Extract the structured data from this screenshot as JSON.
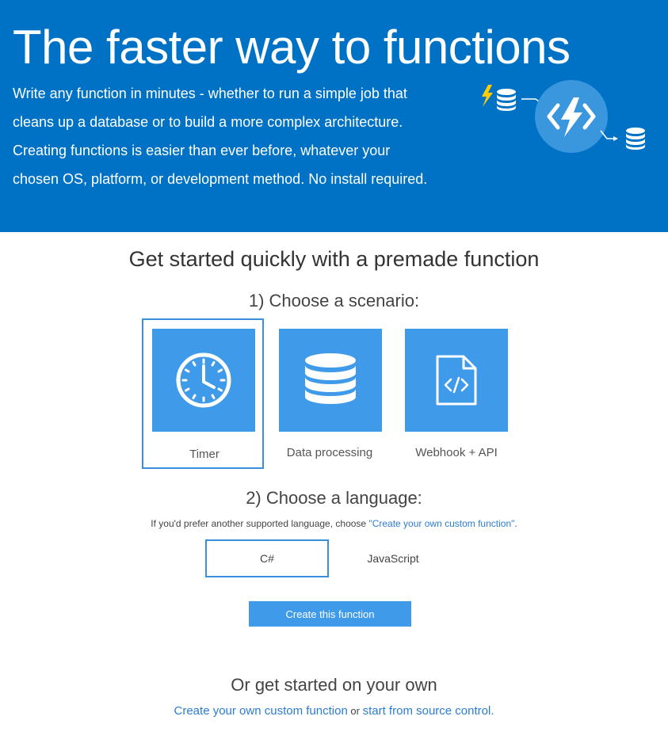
{
  "hero": {
    "title": "The faster way to functions",
    "description_lines": [
      "Write any function in minutes - whether to run a simple job that",
      "cleans up a database or to build a more complex architecture.",
      "Creating functions is easier than ever before, whatever your",
      "chosen OS, platform, or development method. No install required."
    ],
    "icons": [
      "lightning-icon",
      "database-icon",
      "function-app-icon",
      "database-icon"
    ]
  },
  "quickstart": {
    "heading": "Get started quickly with a premade function",
    "step1": "1) Choose a scenario:",
    "scenarios": [
      {
        "label": "Timer",
        "icon": "clock-icon",
        "selected": true
      },
      {
        "label": "Data processing",
        "icon": "database-icon",
        "selected": false
      },
      {
        "label": "Webhook + API",
        "icon": "code-document-icon",
        "selected": false
      }
    ],
    "step2": "2) Choose a language:",
    "language_hint_prefix": "If you'd prefer another supported language, choose ",
    "language_hint_link": "\"Create your own custom function\"",
    "language_hint_suffix": ".",
    "languages": [
      {
        "label": "C#",
        "selected": true
      },
      {
        "label": "JavaScript",
        "selected": false
      }
    ],
    "create_button": "Create this function"
  },
  "own": {
    "heading": "Or get started on your own",
    "link_custom": "Create your own custom function",
    "or_text": " or ",
    "link_source": "start from source control."
  },
  "colors": {
    "hero_bg": "#0072c6",
    "tile_bg": "#3f9bea",
    "selected_border": "#3a8fdb",
    "link": "#2b7cd3",
    "lightning": "#ffcd00",
    "function_circle": "#3a96dd"
  }
}
